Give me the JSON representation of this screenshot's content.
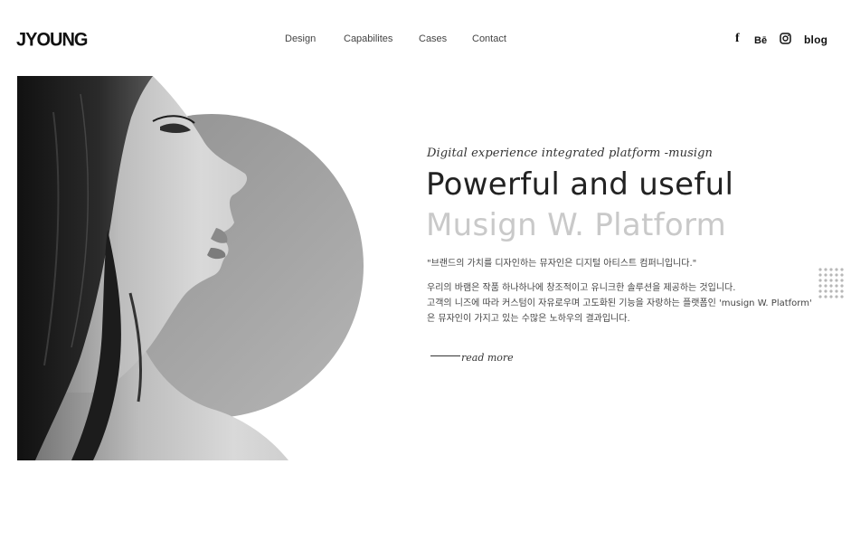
{
  "header": {
    "logo": "JYOUNG",
    "nav": [
      "Design",
      "Capabilites",
      "Cases",
      "Contact"
    ],
    "social": {
      "facebook": "f",
      "behance": "Bē",
      "instagram_icon": "instagram-icon",
      "blog": "blog"
    }
  },
  "hero": {
    "subtitle": "Digital experience integrated platform -musign",
    "title_line1": "Powerful and useful",
    "title_line2": "Musign W. Platform",
    "quote": "\"브랜드의 가치를 디자인하는 뮤자인은 디지털 아티스트 컴퍼니입니다.\"",
    "description": [
      "우리의 바램은 작품 하나하나에 창조적이고 유니크한 솔루션을 제공하는 것입니다.",
      "고객의 니즈에 따라 커스텀이 자유로우며 고도화된 기능을 자랑하는 플랫폼인 'musign W. Platform'",
      "은 뮤자인이 가지고 있는 수많은 노하우의 결과입니다."
    ],
    "read_more": "read more"
  },
  "colors": {
    "title": "#222222",
    "title_light": "#c9c9c9",
    "circle": "#a3a3a3",
    "dots": "#b8b8b8"
  }
}
